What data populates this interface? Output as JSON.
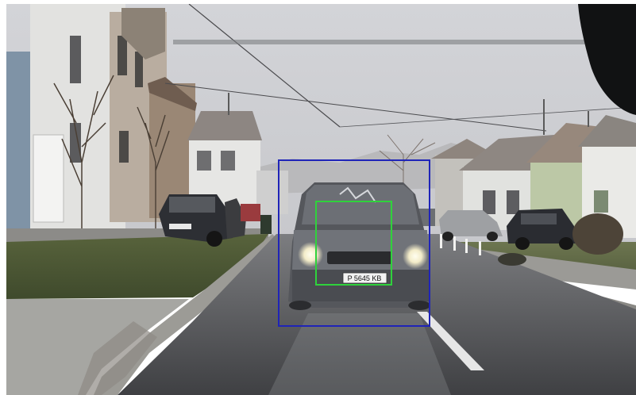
{
  "image": {
    "description_free": true,
    "detections": [
      {
        "label": "vehicle-detection",
        "color": "#1f24b8"
      },
      {
        "label": "vehicle-front-detection",
        "color": "#2fd23c"
      }
    ],
    "license_plate_text": "P 5645 KB"
  }
}
